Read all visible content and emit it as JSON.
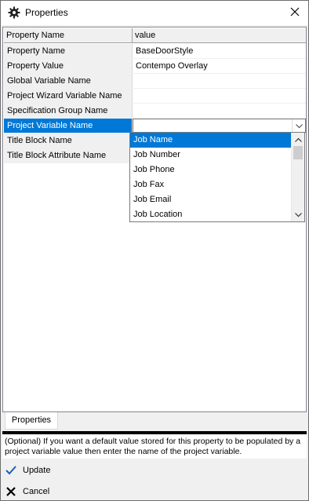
{
  "window": {
    "title": "Properties",
    "icon": "gear-icon",
    "close_icon": "close-icon"
  },
  "grid": {
    "headers": [
      "Property Name",
      "value"
    ],
    "rows": [
      {
        "name": "Property Name",
        "value": "BaseDoorStyle"
      },
      {
        "name": "Property Value",
        "value": "Contempo Overlay"
      },
      {
        "name": "Global Variable Name",
        "value": ""
      },
      {
        "name": "Project Wizard Variable Name",
        "value": ""
      },
      {
        "name": "Specification Group Name",
        "value": ""
      },
      {
        "name": "Project Variable Name",
        "value": ""
      },
      {
        "name": "Title Block Name",
        "value": ""
      },
      {
        "name": "Title Block Attribute Name",
        "value": ""
      }
    ]
  },
  "dropdown": {
    "items": [
      "Job Name",
      "Job Number",
      "Job Phone",
      "Job Fax",
      "Job Email",
      "Job Location"
    ],
    "highlighted": "Job Name"
  },
  "tabs": [
    "Properties"
  ],
  "description": "(Optional) If you want a default value stored for this property to be populated by a project variable value then enter the name of the project variable.",
  "actions": {
    "update_label": "Update",
    "cancel_label": "Cancel"
  },
  "colors": {
    "selection": "#0078d7",
    "update_check": "#1a5fb4"
  }
}
